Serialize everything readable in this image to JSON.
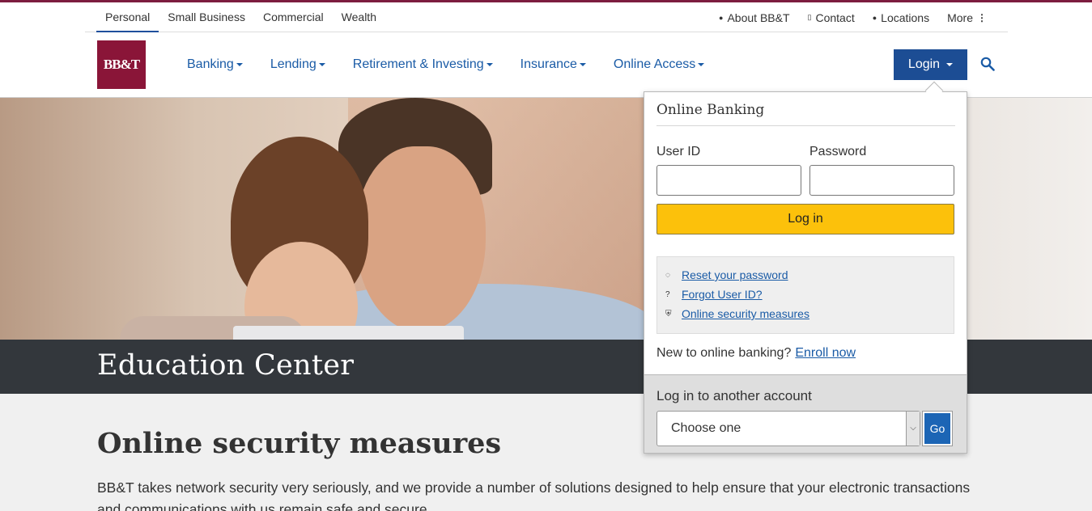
{
  "segments": [
    {
      "label": "Personal",
      "active": true
    },
    {
      "label": "Small Business"
    },
    {
      "label": "Commercial"
    },
    {
      "label": "Wealth"
    }
  ],
  "utility_links": [
    {
      "label": "About BB&T",
      "icon": "person-icon"
    },
    {
      "label": "Contact",
      "icon": "phone-icon"
    },
    {
      "label": "Locations",
      "icon": "map-pin-icon"
    },
    {
      "label": "More",
      "icon": "vertical-ellipsis-icon"
    }
  ],
  "logo": {
    "text": "BB&T",
    "color": "#8a1538"
  },
  "main_nav": [
    {
      "label": "Banking"
    },
    {
      "label": "Lending"
    },
    {
      "label": "Retirement & Investing"
    },
    {
      "label": "Insurance"
    },
    {
      "label": "Online Access"
    }
  ],
  "login_button": {
    "label": "Login"
  },
  "hero": {
    "band_title": "Education Center"
  },
  "page": {
    "title": "Online security measures",
    "intro": "BB&T takes network security very seriously, and we provide a number of solutions designed to help ensure that your electronic transactions and communications with us remain safe and secure."
  },
  "login_panel": {
    "title": "Online Banking",
    "user_id_label": "User ID",
    "user_id_value": "",
    "password_label": "Password",
    "password_value": "",
    "submit_label": "Log in",
    "help_links": [
      {
        "label": "Reset your password",
        "icon": "key-icon"
      },
      {
        "label": "Forgot User ID?",
        "icon": "question-icon"
      },
      {
        "label": "Online security measures",
        "icon": "shield-icon"
      }
    ],
    "enroll_prompt": "New to online banking?",
    "enroll_link": "Enroll now",
    "other_account_label": "Log in to another account",
    "select_value": "Choose one",
    "go_label": "Go"
  },
  "colors": {
    "brand": "#8a1538",
    "nav_link": "#1a5ba6",
    "login_button": "#1c4d94",
    "submit_button": "#fcc10b",
    "band": "#33373c"
  }
}
